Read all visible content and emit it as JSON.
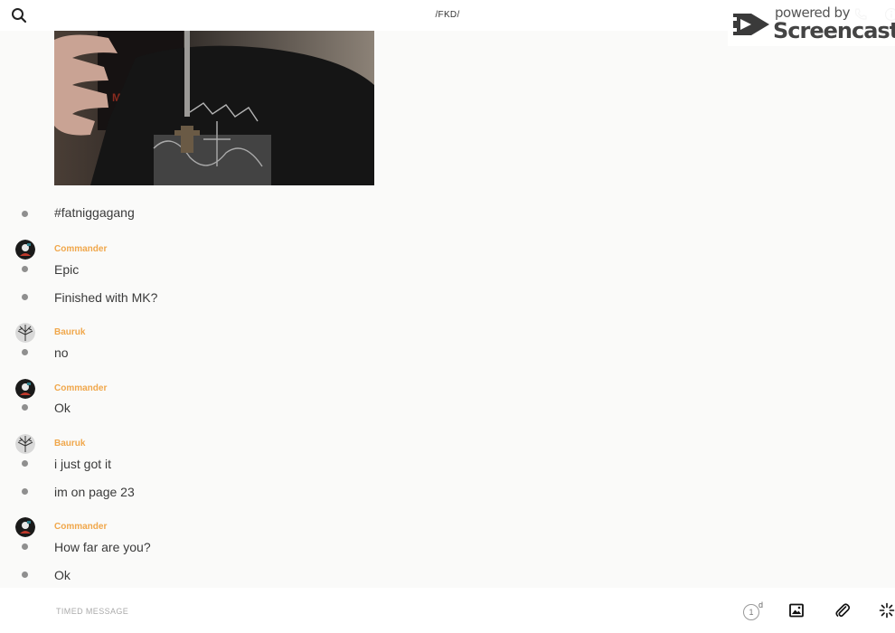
{
  "header": {
    "title": "/FKD/",
    "icons": {
      "search": "search-icon",
      "call": "phone-icon",
      "info": "info-icon"
    }
  },
  "watermark": {
    "powered_by": "powered by",
    "brand": "Screencastify"
  },
  "messages": [
    {
      "text": "#fatniggagang"
    },
    {
      "sender": "Commander",
      "text": "Epic"
    },
    {
      "text": "Finished with MK?"
    },
    {
      "sender": "Bauruk",
      "text": "no"
    },
    {
      "sender": "Commander",
      "text": "Ok"
    },
    {
      "sender": "Bauruk",
      "text": "i just got it"
    },
    {
      "text": "im on page 23"
    },
    {
      "sender": "Commander",
      "text": "How far are you?"
    },
    {
      "text": "Ok"
    }
  ],
  "composer": {
    "placeholder": "TIMED MESSAGE",
    "timer_value": "1",
    "timer_unit": "d",
    "icons": {
      "image": "image-icon",
      "attach": "paperclip-icon",
      "spark": "sparkle-icon"
    }
  },
  "colors": {
    "sender": "#f0a74b",
    "bullet": "#8f8f8f",
    "background": "#fafaf9"
  }
}
